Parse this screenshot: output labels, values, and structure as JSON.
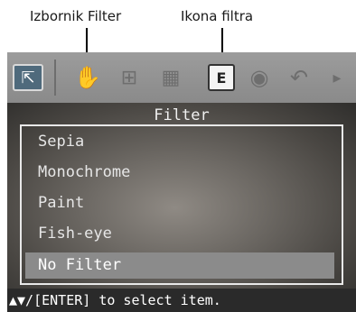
{
  "callouts": {
    "filter_menu": "Izbornik Filter",
    "filter_icon": "Ikona filtra"
  },
  "toolbar": {
    "icons": [
      "select-icon",
      "hand-icon",
      "rotate-icon",
      "adjust-icon",
      "filter-icon",
      "eye-icon",
      "undo-icon",
      "arrow-right-icon"
    ],
    "select_glyph": "⇱",
    "hand_glyph": "✋",
    "rotate_glyph": "⊞",
    "adjust_glyph": "▦",
    "filter_glyph": "E",
    "eye_glyph": "◉",
    "undo_glyph": "↶",
    "next_glyph": "▸"
  },
  "menu": {
    "title": "Filter",
    "items": [
      {
        "label": "Sepia",
        "selected": false
      },
      {
        "label": "Monochrome",
        "selected": false
      },
      {
        "label": "Paint",
        "selected": false
      },
      {
        "label": "Fish-eye",
        "selected": false
      },
      {
        "label": "No Filter",
        "selected": true
      }
    ]
  },
  "status": {
    "hint": "▲▼/[ENTER] to select item."
  }
}
